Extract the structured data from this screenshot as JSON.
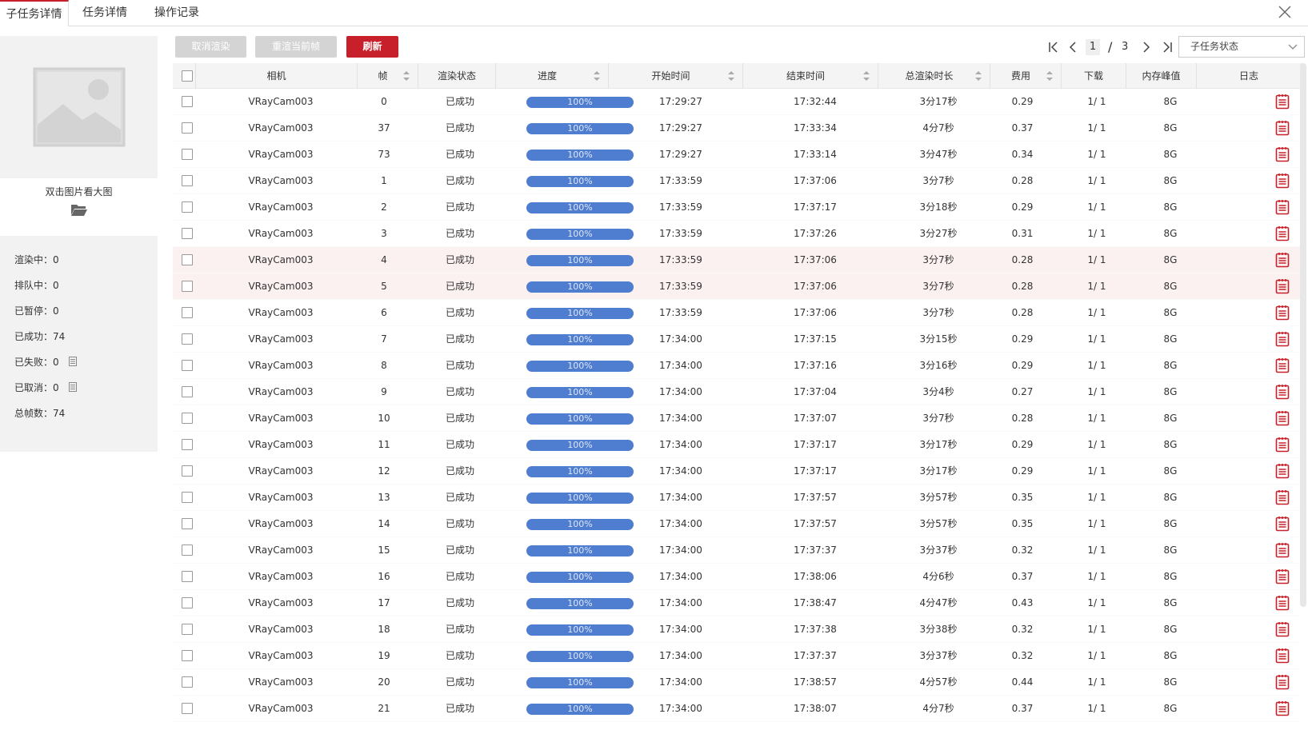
{
  "tabs": [
    "子任务详情",
    "任务详情",
    "操作记录"
  ],
  "sidebar": {
    "caption": "双击图片看大图",
    "stats": [
      {
        "label": "渲染中：",
        "value": "0"
      },
      {
        "label": "排队中：",
        "value": "0"
      },
      {
        "label": "已暂停：",
        "value": "0"
      },
      {
        "label": "已成功：",
        "value": "74"
      },
      {
        "label": "已失败：",
        "value": "0"
      },
      {
        "label": "已取消：",
        "value": "0"
      },
      {
        "label": "总帧数：",
        "value": "74"
      }
    ]
  },
  "toolbar": {
    "cancel_label": "取消渲染",
    "rerender_label": "重渲当前帧",
    "refresh_label": "刷新"
  },
  "pager": {
    "current": "1",
    "separator": "/",
    "total": "3"
  },
  "status_select": {
    "value": "子任务状态"
  },
  "colors": {
    "accent": "#c8202a",
    "progress": "#4f7dd0"
  },
  "table": {
    "headers": [
      "相机",
      "帧",
      "渲染状态",
      "进度",
      "开始时间",
      "结束时间",
      "总渲染时长",
      "费用",
      "下载",
      "内存峰值",
      "日志"
    ],
    "rows": [
      {
        "camera": "VRayCam003",
        "frame": "0",
        "status": "已成功",
        "progress": "100%",
        "start": "17:29:27",
        "end": "17:32:44",
        "duration": "3分17秒",
        "cost": "0.29",
        "download": "1/ 1",
        "memory": "8G"
      },
      {
        "camera": "VRayCam003",
        "frame": "37",
        "status": "已成功",
        "progress": "100%",
        "start": "17:29:27",
        "end": "17:33:34",
        "duration": "4分7秒",
        "cost": "0.37",
        "download": "1/ 1",
        "memory": "8G"
      },
      {
        "camera": "VRayCam003",
        "frame": "73",
        "status": "已成功",
        "progress": "100%",
        "start": "17:29:27",
        "end": "17:33:14",
        "duration": "3分47秒",
        "cost": "0.34",
        "download": "1/ 1",
        "memory": "8G"
      },
      {
        "camera": "VRayCam003",
        "frame": "1",
        "status": "已成功",
        "progress": "100%",
        "start": "17:33:59",
        "end": "17:37:06",
        "duration": "3分7秒",
        "cost": "0.28",
        "download": "1/ 1",
        "memory": "8G"
      },
      {
        "camera": "VRayCam003",
        "frame": "2",
        "status": "已成功",
        "progress": "100%",
        "start": "17:33:59",
        "end": "17:37:17",
        "duration": "3分18秒",
        "cost": "0.29",
        "download": "1/ 1",
        "memory": "8G"
      },
      {
        "camera": "VRayCam003",
        "frame": "3",
        "status": "已成功",
        "progress": "100%",
        "start": "17:33:59",
        "end": "17:37:26",
        "duration": "3分27秒",
        "cost": "0.31",
        "download": "1/ 1",
        "memory": "8G"
      },
      {
        "camera": "VRayCam003",
        "frame": "4",
        "status": "已成功",
        "progress": "100%",
        "start": "17:33:59",
        "end": "17:37:06",
        "duration": "3分7秒",
        "cost": "0.28",
        "download": "1/ 1",
        "memory": "8G"
      },
      {
        "camera": "VRayCam003",
        "frame": "5",
        "status": "已成功",
        "progress": "100%",
        "start": "17:33:59",
        "end": "17:37:06",
        "duration": "3分7秒",
        "cost": "0.28",
        "download": "1/ 1",
        "memory": "8G"
      },
      {
        "camera": "VRayCam003",
        "frame": "6",
        "status": "已成功",
        "progress": "100%",
        "start": "17:33:59",
        "end": "17:37:06",
        "duration": "3分7秒",
        "cost": "0.28",
        "download": "1/ 1",
        "memory": "8G"
      },
      {
        "camera": "VRayCam003",
        "frame": "7",
        "status": "已成功",
        "progress": "100%",
        "start": "17:34:00",
        "end": "17:37:15",
        "duration": "3分15秒",
        "cost": "0.29",
        "download": "1/ 1",
        "memory": "8G"
      },
      {
        "camera": "VRayCam003",
        "frame": "8",
        "status": "已成功",
        "progress": "100%",
        "start": "17:34:00",
        "end": "17:37:16",
        "duration": "3分16秒",
        "cost": "0.29",
        "download": "1/ 1",
        "memory": "8G"
      },
      {
        "camera": "VRayCam003",
        "frame": "9",
        "status": "已成功",
        "progress": "100%",
        "start": "17:34:00",
        "end": "17:37:04",
        "duration": "3分4秒",
        "cost": "0.27",
        "download": "1/ 1",
        "memory": "8G"
      },
      {
        "camera": "VRayCam003",
        "frame": "10",
        "status": "已成功",
        "progress": "100%",
        "start": "17:34:00",
        "end": "17:37:07",
        "duration": "3分7秒",
        "cost": "0.28",
        "download": "1/ 1",
        "memory": "8G"
      },
      {
        "camera": "VRayCam003",
        "frame": "11",
        "status": "已成功",
        "progress": "100%",
        "start": "17:34:00",
        "end": "17:37:17",
        "duration": "3分17秒",
        "cost": "0.29",
        "download": "1/ 1",
        "memory": "8G"
      },
      {
        "camera": "VRayCam003",
        "frame": "12",
        "status": "已成功",
        "progress": "100%",
        "start": "17:34:00",
        "end": "17:37:17",
        "duration": "3分17秒",
        "cost": "0.29",
        "download": "1/ 1",
        "memory": "8G"
      },
      {
        "camera": "VRayCam003",
        "frame": "13",
        "status": "已成功",
        "progress": "100%",
        "start": "17:34:00",
        "end": "17:37:57",
        "duration": "3分57秒",
        "cost": "0.35",
        "download": "1/ 1",
        "memory": "8G"
      },
      {
        "camera": "VRayCam003",
        "frame": "14",
        "status": "已成功",
        "progress": "100%",
        "start": "17:34:00",
        "end": "17:37:57",
        "duration": "3分57秒",
        "cost": "0.35",
        "download": "1/ 1",
        "memory": "8G"
      },
      {
        "camera": "VRayCam003",
        "frame": "15",
        "status": "已成功",
        "progress": "100%",
        "start": "17:34:00",
        "end": "17:37:37",
        "duration": "3分37秒",
        "cost": "0.32",
        "download": "1/ 1",
        "memory": "8G"
      },
      {
        "camera": "VRayCam003",
        "frame": "16",
        "status": "已成功",
        "progress": "100%",
        "start": "17:34:00",
        "end": "17:38:06",
        "duration": "4分6秒",
        "cost": "0.37",
        "download": "1/ 1",
        "memory": "8G"
      },
      {
        "camera": "VRayCam003",
        "frame": "17",
        "status": "已成功",
        "progress": "100%",
        "start": "17:34:00",
        "end": "17:38:47",
        "duration": "4分47秒",
        "cost": "0.43",
        "download": "1/ 1",
        "memory": "8G"
      },
      {
        "camera": "VRayCam003",
        "frame": "18",
        "status": "已成功",
        "progress": "100%",
        "start": "17:34:00",
        "end": "17:37:38",
        "duration": "3分38秒",
        "cost": "0.32",
        "download": "1/ 1",
        "memory": "8G"
      },
      {
        "camera": "VRayCam003",
        "frame": "19",
        "status": "已成功",
        "progress": "100%",
        "start": "17:34:00",
        "end": "17:37:37",
        "duration": "3分37秒",
        "cost": "0.32",
        "download": "1/ 1",
        "memory": "8G"
      },
      {
        "camera": "VRayCam003",
        "frame": "20",
        "status": "已成功",
        "progress": "100%",
        "start": "17:34:00",
        "end": "17:38:57",
        "duration": "4分57秒",
        "cost": "0.44",
        "download": "1/ 1",
        "memory": "8G"
      },
      {
        "camera": "VRayCam003",
        "frame": "21",
        "status": "已成功",
        "progress": "100%",
        "start": "17:34:00",
        "end": "17:38:07",
        "duration": "4分7秒",
        "cost": "0.37",
        "download": "1/ 1",
        "memory": "8G"
      }
    ]
  }
}
